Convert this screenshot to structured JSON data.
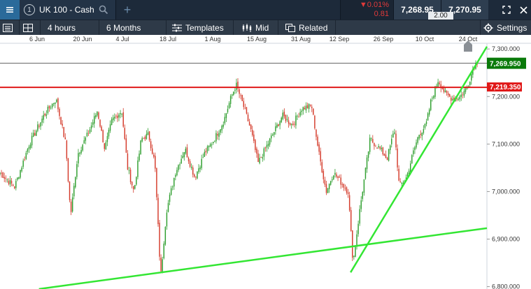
{
  "instrument": {
    "number": "1",
    "name": "UK 100 - Cash"
  },
  "quote": {
    "change_pct": "▼0.01%",
    "change_abs": "0.81",
    "sell": "7,268.95",
    "buy": "7,270.95",
    "spread": "2.00",
    "down_color": "#e03a3a"
  },
  "toolbar": {
    "interval": "4 hours",
    "range": "6 Months",
    "templates": "Templates",
    "price_type": "Mid",
    "related": "Related",
    "settings": "Settings"
  },
  "icons": [
    "menu-icon",
    "search-icon",
    "add-tab-icon",
    "expand-icon",
    "close-icon",
    "list-icon",
    "layout-icon",
    "templates-icon",
    "candles-icon",
    "related-icon",
    "gear-icon",
    "bell-icon"
  ],
  "colors": {
    "up": "#2e9e2e",
    "down": "#d43a2a",
    "trendline": "#33e633",
    "resistance": "#e01818",
    "price_line": "#0a7a0a",
    "header": "#1d2a3a"
  },
  "chart_data": {
    "type": "candlestick",
    "x_ticks": [
      "6 Jun",
      "20 Jun",
      "4 Jul",
      "18 Jul",
      "1 Aug",
      "15 Aug",
      "31 Aug",
      "12 Sep",
      "26 Sep",
      "10 Oct",
      "24 Oct"
    ],
    "y_ticks": [
      "7,300.000",
      "7,200.000",
      "7,100.000",
      "7,000.000",
      "6,900.000",
      "6,800.000"
    ],
    "ylim": [
      6795,
      7312
    ],
    "current_price": {
      "value": 7269.95,
      "label": "7,269.950"
    },
    "resistance": {
      "value": 7219.35,
      "label": "7,219.350"
    },
    "anchors": [
      [
        0,
        7040
      ],
      [
        0.03,
        7010
      ],
      [
        0.06,
        7100
      ],
      [
        0.09,
        7160
      ],
      [
        0.115,
        7195
      ],
      [
        0.135,
        7100
      ],
      [
        0.145,
        6950
      ],
      [
        0.16,
        7080
      ],
      [
        0.18,
        7120
      ],
      [
        0.2,
        7170
      ],
      [
        0.215,
        7090
      ],
      [
        0.23,
        7150
      ],
      [
        0.25,
        7170
      ],
      [
        0.262,
        7050
      ],
      [
        0.275,
        7000
      ],
      [
        0.29,
        7110
      ],
      [
        0.305,
        7120
      ],
      [
        0.318,
        7060
      ],
      [
        0.33,
        6820
      ],
      [
        0.342,
        6960
      ],
      [
        0.36,
        7040
      ],
      [
        0.38,
        7090
      ],
      [
        0.4,
        7030
      ],
      [
        0.42,
        7080
      ],
      [
        0.44,
        7110
      ],
      [
        0.46,
        7150
      ],
      [
        0.475,
        7200
      ],
      [
        0.485,
        7225
      ],
      [
        0.5,
        7180
      ],
      [
        0.515,
        7130
      ],
      [
        0.53,
        7060
      ],
      [
        0.545,
        7090
      ],
      [
        0.56,
        7120
      ],
      [
        0.58,
        7160
      ],
      [
        0.6,
        7140
      ],
      [
        0.62,
        7175
      ],
      [
        0.64,
        7180
      ],
      [
        0.655,
        7080
      ],
      [
        0.67,
        7000
      ],
      [
        0.685,
        7040
      ],
      [
        0.7,
        7020
      ],
      [
        0.715,
        7000
      ],
      [
        0.725,
        6850
      ],
      [
        0.74,
        6970
      ],
      [
        0.76,
        7110
      ],
      [
        0.78,
        7090
      ],
      [
        0.795,
        7070
      ],
      [
        0.81,
        7130
      ],
      [
        0.82,
        7010
      ],
      [
        0.835,
        7030
      ],
      [
        0.848,
        7080
      ],
      [
        0.86,
        7120
      ],
      [
        0.875,
        7140
      ],
      [
        0.885,
        7190
      ],
      [
        0.9,
        7235
      ],
      [
        0.915,
        7205
      ],
      [
        0.93,
        7195
      ],
      [
        0.945,
        7200
      ],
      [
        0.96,
        7220
      ],
      [
        0.972,
        7262
      ],
      [
        0.98,
        7273
      ]
    ]
  }
}
